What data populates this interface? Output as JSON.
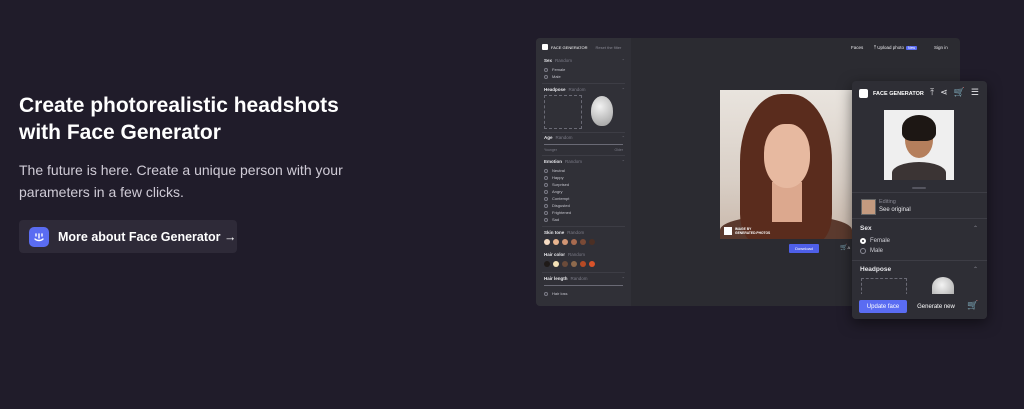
{
  "hero": {
    "title": "Create photorealistic headshots with Face Generator",
    "subtitle": "The future is here. Create a unique person with your parameters in a few clicks.",
    "cta_label": "More about Face Generator →"
  },
  "app": {
    "brand": "FACE GENERATOR",
    "reset": "Reset the filter",
    "nav": {
      "faces": "Faces",
      "upload": "Upload photo",
      "new_badge": "New",
      "signin": "Sign in"
    },
    "sidebar": {
      "sex": {
        "title": "Sex",
        "value": "Random",
        "options": [
          "Female",
          "Male"
        ]
      },
      "headpose": {
        "title": "Headpose",
        "value": "Random"
      },
      "age": {
        "title": "Age",
        "value": "Random",
        "min_label": "Younger",
        "max_label": "Older"
      },
      "emotion": {
        "title": "Emotion",
        "value": "Random",
        "options": [
          "Neutral",
          "Happy",
          "Surprised",
          "Angry",
          "Contempt",
          "Disgusted",
          "Frightened",
          "Sad"
        ]
      },
      "skin_tone": {
        "title": "Skin tone",
        "value": "Random",
        "swatches": [
          "#f6dcc4",
          "#e7b48f",
          "#d19574",
          "#a86a4f",
          "#7a4a36",
          "#4b2f24"
        ]
      },
      "hair_color": {
        "title": "Hair color",
        "value": "Random",
        "swatches": [
          "#1f1a18",
          "#f4e2b8",
          "#6b4b3a",
          "#8e6a4d",
          "#b54a25",
          "#d9532a"
        ]
      },
      "hair_length": {
        "title": "Hair length",
        "value": "Random",
        "option": "Hair loss"
      }
    },
    "watermark": "IMAGE BY\nGENERATED.PHOTOS",
    "download": "Download",
    "cart_hint": "A"
  },
  "mobile": {
    "brand": "FACE GENERATOR",
    "editing": "Editing",
    "see_original": "See original",
    "sex_title": "Sex",
    "sex_options": [
      "Female",
      "Male"
    ],
    "headpose_title": "Headpose",
    "update_face": "Update face",
    "generate_new": "Generate new"
  },
  "colors": {
    "background": "#201c2a",
    "accent": "#5a6cf2"
  }
}
